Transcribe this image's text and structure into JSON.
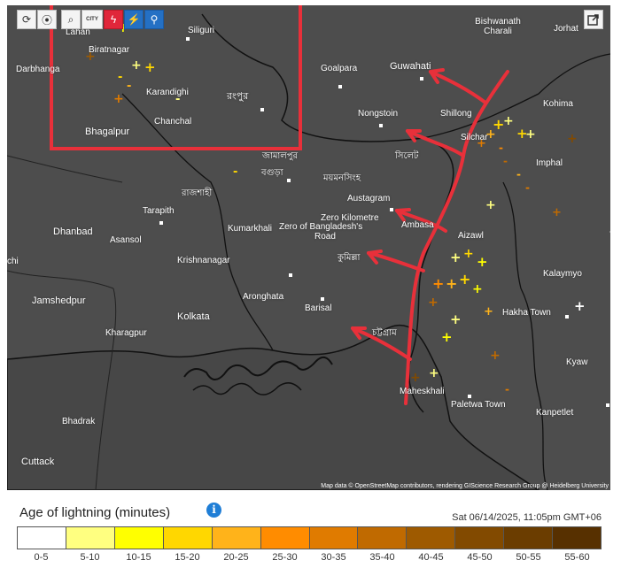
{
  "toolbar": {
    "refresh_icon": "refresh-icon",
    "locate_icon": "map-pin-icon",
    "zoom_icon": "zoom-icon",
    "city_label": "CITY",
    "lightning_icon": "lightning-icon",
    "person_icon": "weather-station-icon",
    "satellite_icon": "satellite-icon"
  },
  "share_icon": "share-icon",
  "places": [
    "Lahan",
    "Siliguri",
    "Bishwanath Charali",
    "Jorhat",
    "Biratnagar",
    "Darbhanga",
    "Goalpara",
    "Guwahati",
    "Karandighi",
    "রংপুর",
    "Kohima",
    "Nongstoin",
    "Shillong",
    "Chanchal",
    "Bhagalpur",
    "Silchar",
    "Imphal",
    "জামালপুর",
    "বগুড়া",
    "ময়মনসিংহ",
    "সিলেট",
    "রাজশাহী",
    "Austagram",
    "Tarapith",
    "Zero Kilometre",
    "Zero of Bangladesh's",
    "Road",
    "Ambasa",
    "Aizawl",
    "Dhanbad",
    "Asansol",
    "Kumarkhali",
    "Krishnanagar",
    "কুমিল্লা",
    "Kalaymyo",
    "Jamshedpur",
    "Aronghata",
    "Barisal",
    "Hakha Town",
    "Kolkata",
    "Kharagpur",
    "চট্টগ্রাম",
    "Kyaw",
    "Maheskhali",
    "Paletwa Town",
    "Kanpetlet",
    "Bhadrak",
    "Cuttack",
    "chi"
  ],
  "attribution": "Map data © OpenStreetMap contributors, rendering GIScience Research Group @ Heidelberg University",
  "legend": {
    "title": "Age of lightning (minutes)",
    "info_icon": "info-icon",
    "timestamp": "Sat 06/14/2025, 11:05pm GMT+06",
    "ranges": [
      "0-5",
      "5-10",
      "10-15",
      "15-20",
      "20-25",
      "25-30",
      "30-35",
      "35-40",
      "40-45",
      "45-50",
      "50-55",
      "55-60"
    ],
    "colors": [
      "#ffffff",
      "#ffff80",
      "#ffff00",
      "#ffd700",
      "#ffb31a",
      "#ff8c00",
      "#e07b00",
      "#c06a00",
      "#9e5a00",
      "#824a00",
      "#6b3d00",
      "#573000"
    ]
  }
}
